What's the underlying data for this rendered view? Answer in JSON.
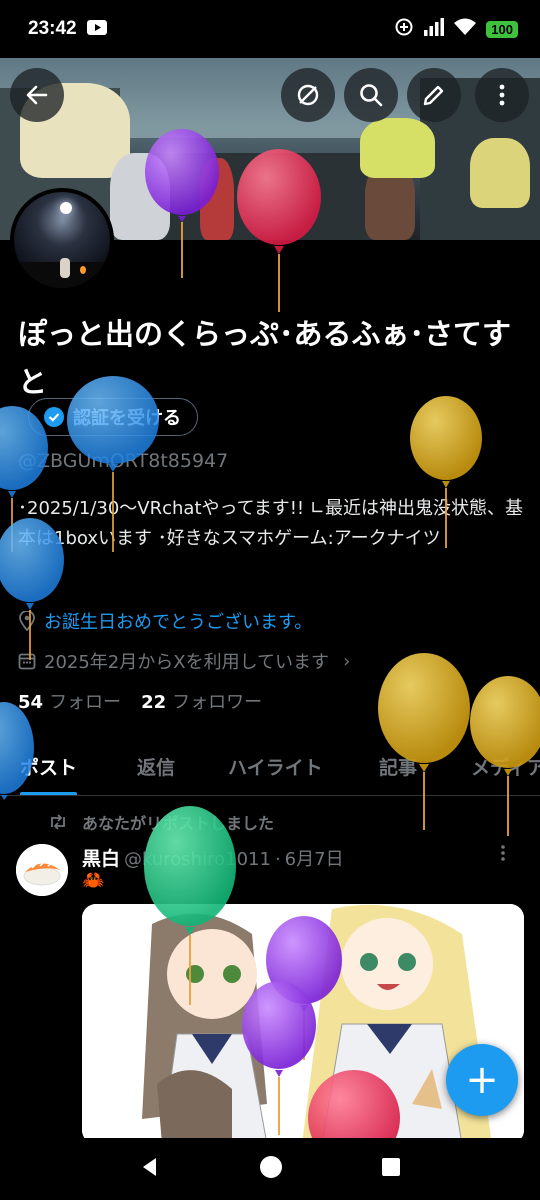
{
  "status_bar": {
    "time": "23:42",
    "battery": "100",
    "icons": [
      "youtube-icon",
      "data-saver-icon",
      "signal-icon",
      "wifi-icon",
      "battery-icon"
    ]
  },
  "header": {
    "actions": [
      "back-icon",
      "repost-off-icon",
      "search-icon",
      "edit-icon",
      "more-vertical-icon"
    ]
  },
  "profile": {
    "name": "ぽっと出のくらっぷ･あるふぁ･さてすと",
    "verify_label": "認証を受ける",
    "handle": "@ZBGUmORT8t85947",
    "bio": "･2025/1/30～VRchatやってます!! ∟最近は神出鬼没状態、基本は1boxいます ･好きなスマホゲーム:アークナイツ",
    "birthday_text": "お誕生日おめでとうございます。",
    "joined_text": "2025年2月からXを利用しています",
    "following_count": "54",
    "following_label": "フォロー",
    "followers_count": "22",
    "followers_label": "フォロワー"
  },
  "tabs": [
    {
      "label": "ポスト",
      "active": true
    },
    {
      "label": "返信",
      "active": false
    },
    {
      "label": "ハイライト",
      "active": false
    },
    {
      "label": "記事",
      "active": false
    },
    {
      "label": "メディア",
      "active": false
    }
  ],
  "post": {
    "repost_label": "あなたがリポストしました",
    "author": "黒白",
    "handle": "@kuroshiro1011",
    "separator": "·",
    "date": "6月7日",
    "emoji": "🦀"
  },
  "fab_label": "+",
  "colors": {
    "accent": "#1d9bf0",
    "background": "#000000",
    "muted": "#71767b"
  }
}
